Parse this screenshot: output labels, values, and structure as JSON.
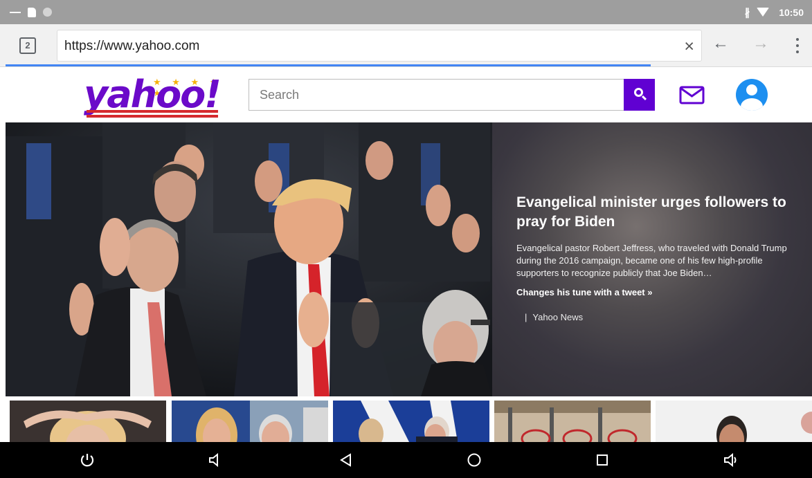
{
  "status_bar": {
    "time": "10:50",
    "icons": [
      "minimize-dash-icon",
      "sd-card-icon",
      "circle-dot-icon",
      "bluetooth-icon",
      "wifi-icon"
    ]
  },
  "browser": {
    "tab_count": "2",
    "url": "https://www.yahoo.com",
    "clear_icon": "×",
    "back_icon": "←",
    "forward_icon": "→",
    "load_progress": 0.8
  },
  "yahoo": {
    "logo_text": "yahoo!",
    "logo_stars": "★ ★ ★ ★ ★",
    "search_placeholder": "Search",
    "accent_color": "#6001d2"
  },
  "hero": {
    "headline": "Evangelical minister urges followers to pray for Biden",
    "summary": "Evangelical pastor Robert Jeffress, who traveled with Donald Trump during the 2016 campaign, became one of his few high-profile supporters to recognize publicly that Joe Biden…",
    "more_link": "Changes his tune with a tweet »",
    "source_separator": "|",
    "source": "Yahoo News"
  },
  "thumbnails": [
    "thumbnail-1",
    "thumbnail-2",
    "thumbnail-3",
    "thumbnail-4",
    "thumbnail-5"
  ],
  "android_nav": [
    "power-icon",
    "volume-down-icon",
    "back-triangle-icon",
    "home-circle-icon",
    "recents-square-icon",
    "volume-up-icon"
  ]
}
